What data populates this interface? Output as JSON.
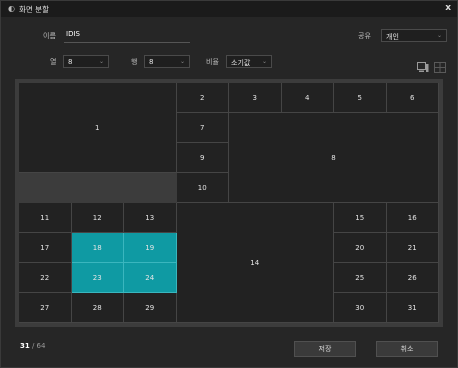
{
  "window": {
    "title": "화면 분할",
    "close_label": "x"
  },
  "form": {
    "name_label": "이름",
    "name_value": "IDIS",
    "share_label": "공유",
    "share_value": "개인",
    "row_label": "열",
    "row_value": "8",
    "col_label": "행",
    "col_value": "8",
    "ratio_label": "비율",
    "ratio_value": "소기값"
  },
  "grid": {
    "cells": [
      {
        "label": "1"
      },
      {
        "label": "2"
      },
      {
        "label": "3"
      },
      {
        "label": "4"
      },
      {
        "label": "5"
      },
      {
        "label": "6"
      },
      {
        "label": "7"
      },
      {
        "label": "8"
      },
      {
        "label": "9"
      },
      {
        "label": "10"
      },
      {
        "label": "11"
      },
      {
        "label": "12"
      },
      {
        "label": "13"
      },
      {
        "label": "14"
      },
      {
        "label": "15"
      },
      {
        "label": "16"
      },
      {
        "label": "17"
      },
      {
        "label": "18"
      },
      {
        "label": "19"
      },
      {
        "label": "20"
      },
      {
        "label": "21"
      },
      {
        "label": "22"
      },
      {
        "label": "23"
      },
      {
        "label": "24"
      },
      {
        "label": "25"
      },
      {
        "label": "26"
      },
      {
        "label": "27"
      },
      {
        "label": "28"
      },
      {
        "label": "29"
      },
      {
        "label": "30"
      },
      {
        "label": "31"
      }
    ],
    "selected": [
      "18",
      "19",
      "23",
      "24"
    ]
  },
  "footer": {
    "count": "31",
    "total": " / 64",
    "save_label": "저장",
    "cancel_label": "취소"
  },
  "colors": {
    "selected": "#0f9aa3",
    "cell": "#222222"
  }
}
